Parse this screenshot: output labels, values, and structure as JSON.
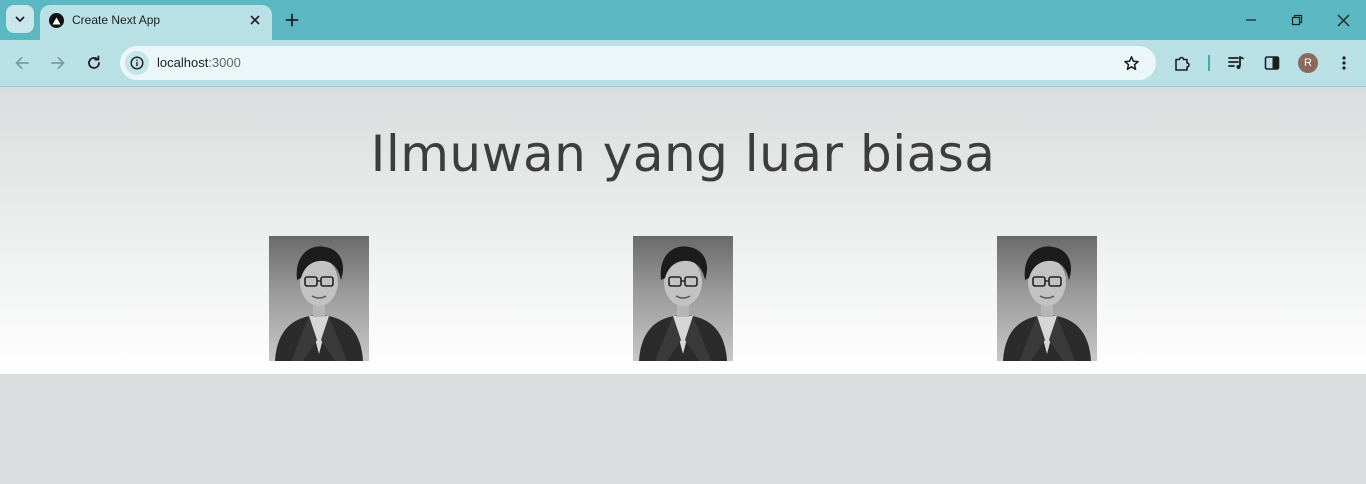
{
  "browser": {
    "tab": {
      "title": "Create Next App",
      "favicon": "nextjs-triangle-icon"
    },
    "address": {
      "host": "localhost",
      "port": ":3000"
    },
    "avatar_initial": "R",
    "colors": {
      "tabbar": "#5bb8c2",
      "toolbar": "#b8e0e5",
      "omnibox": "#eaf6f7"
    }
  },
  "page": {
    "title": "Ilmuwan yang luar biasa",
    "photos": [
      {
        "subject": "scientist-portrait"
      },
      {
        "subject": "scientist-portrait"
      },
      {
        "subject": "scientist-portrait"
      }
    ]
  }
}
